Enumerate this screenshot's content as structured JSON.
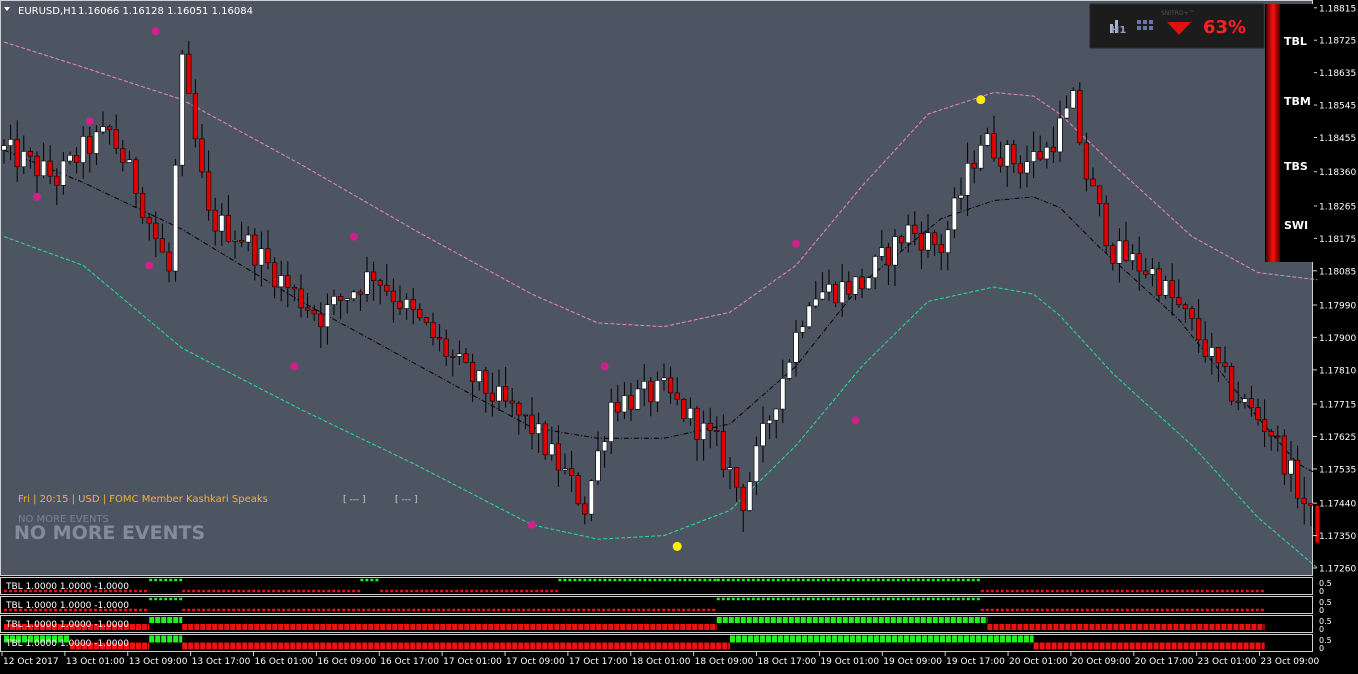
{
  "chart_header": {
    "symbol_tf": "EURUSD,H1",
    "ohlc": "1.16066 1.16128 1.16051 1.16084"
  },
  "news": {
    "line": "Fri  |  20:15  |  USD  |  FOMC Member Kashkari Speaks",
    "slot1": "[ --- ]",
    "slot2": "[ --- ]",
    "no_more_small": "NO MORE EVENTS",
    "no_more_big": "NO MORE EVENTS"
  },
  "strength_widget": {
    "timeframe": "H1",
    "brand": "SNITRO+™",
    "direction": "down",
    "percent": "63%"
  },
  "side_panel": {
    "labels": [
      "TBL",
      "TBM",
      "TBS",
      "SWI"
    ]
  },
  "sub_panels": [
    {
      "label": "TBL 1.0000 1.0000 -1.0000",
      "scale_top": "0.5",
      "scale_bottom": "0"
    },
    {
      "label": "TBL 1.0000 1.0000 -1.0000",
      "scale_top": "0.5",
      "scale_bottom": "0"
    },
    {
      "label": "TBL 1.0000 1.0000 -1.0000",
      "scale_top": "0.5",
      "scale_bottom": "0"
    },
    {
      "label": "TBL 1.0000 1.0000 -1.0000",
      "scale_top": "0.5",
      "scale_bottom": "0"
    }
  ],
  "colors": {
    "chart_bg": "#4e5562",
    "bull": "#ffffff",
    "bear": "#e00000",
    "upper_band": "#e888c0",
    "lower_band": "#20e0a0",
    "mid_line": "#000000",
    "dot_magenta": "#d0208c",
    "dot_yellow": "#ffee00",
    "green": "#22ee22",
    "red": "#ee1111"
  },
  "chart_data": {
    "type": "candlestick",
    "ylim": [
      1.1726,
      1.1882
    ],
    "y_ticks": [
      "1.18815",
      "1.18725",
      "1.18635",
      "1.18545",
      "1.18455",
      "1.18360",
      "1.18265",
      "1.18175",
      "1.18085",
      "1.17990",
      "1.17900",
      "1.17810",
      "1.17715",
      "1.17625",
      "1.17535",
      "1.17440",
      "1.17350",
      "1.17260"
    ],
    "x_ticks": [
      "12 Oct 2017",
      "13 Oct 01:00",
      "13 Oct 09:00",
      "13 Oct 17:00",
      "16 Oct 01:00",
      "16 Oct 09:00",
      "16 Oct 17:00",
      "17 Oct 01:00",
      "17 Oct 09:00",
      "17 Oct 17:00",
      "18 Oct 01:00",
      "18 Oct 09:00",
      "18 Oct 17:00",
      "19 Oct 01:00",
      "19 Oct 09:00",
      "19 Oct 17:00",
      "20 Oct 01:00",
      "20 Oct 09:00",
      "20 Oct 17:00",
      "23 Oct 01:00",
      "23 Oct 09:00"
    ],
    "bars_count": 200,
    "anchors": [
      [
        0,
        1.1842
      ],
      [
        8,
        1.1834
      ],
      [
        12,
        1.1842
      ],
      [
        16,
        1.1847
      ],
      [
        20,
        1.1832
      ],
      [
        25,
        1.1808
      ],
      [
        27,
        1.1865
      ],
      [
        31,
        1.1823
      ],
      [
        36,
        1.1818
      ],
      [
        44,
        1.1802
      ],
      [
        48,
        1.1796
      ],
      [
        56,
        1.1808
      ],
      [
        62,
        1.1796
      ],
      [
        70,
        1.178
      ],
      [
        80,
        1.1765
      ],
      [
        85,
        1.1752
      ],
      [
        88,
        1.1743
      ],
      [
        92,
        1.1772
      ],
      [
        100,
        1.1775
      ],
      [
        108,
        1.176
      ],
      [
        112,
        1.1745
      ],
      [
        116,
        1.1768
      ],
      [
        122,
        1.1802
      ],
      [
        130,
        1.1805
      ],
      [
        137,
        1.182
      ],
      [
        142,
        1.1815
      ],
      [
        148,
        1.1845
      ],
      [
        154,
        1.1838
      ],
      [
        158,
        1.1842
      ],
      [
        162,
        1.1855
      ],
      [
        164,
        1.1835
      ],
      [
        168,
        1.1814
      ],
      [
        174,
        1.1808
      ],
      [
        180,
        1.1793
      ],
      [
        186,
        1.1775
      ],
      [
        192,
        1.1764
      ],
      [
        196,
        1.1748
      ],
      [
        199,
        1.1736
      ]
    ],
    "overlays": {
      "mid_line": [
        [
          0,
          1.1842
        ],
        [
          12,
          1.1833
        ],
        [
          27,
          1.182
        ],
        [
          45,
          1.18
        ],
        [
          62,
          1.1783
        ],
        [
          80,
          1.1765
        ],
        [
          90,
          1.1762
        ],
        [
          100,
          1.1762
        ],
        [
          110,
          1.1766
        ],
        [
          120,
          1.1782
        ],
        [
          130,
          1.1805
        ],
        [
          142,
          1.1823
        ],
        [
          150,
          1.1828
        ],
        [
          156,
          1.1829
        ],
        [
          160,
          1.1826
        ],
        [
          166,
          1.1815
        ],
        [
          178,
          1.1795
        ],
        [
          188,
          1.1772
        ],
        [
          196,
          1.1755
        ],
        [
          199,
          1.1752
        ]
      ],
      "upper_band": [
        [
          0,
          1.1872
        ],
        [
          12,
          1.1865
        ],
        [
          27,
          1.1856
        ],
        [
          45,
          1.1838
        ],
        [
          62,
          1.182
        ],
        [
          80,
          1.1802
        ],
        [
          90,
          1.1794
        ],
        [
          100,
          1.1793
        ],
        [
          110,
          1.1797
        ],
        [
          120,
          1.181
        ],
        [
          130,
          1.1832
        ],
        [
          140,
          1.1852
        ],
        [
          150,
          1.1858
        ],
        [
          156,
          1.1857
        ],
        [
          160,
          1.1852
        ],
        [
          168,
          1.1838
        ],
        [
          180,
          1.1818
        ],
        [
          190,
          1.1808
        ],
        [
          199,
          1.1806
        ]
      ],
      "lower_band": [
        [
          0,
          1.1818
        ],
        [
          12,
          1.181
        ],
        [
          27,
          1.1787
        ],
        [
          45,
          1.177
        ],
        [
          62,
          1.1755
        ],
        [
          80,
          1.1738
        ],
        [
          90,
          1.1734
        ],
        [
          100,
          1.1735
        ],
        [
          110,
          1.1742
        ],
        [
          120,
          1.176
        ],
        [
          130,
          1.1782
        ],
        [
          140,
          1.18
        ],
        [
          150,
          1.1804
        ],
        [
          156,
          1.1802
        ],
        [
          160,
          1.1796
        ],
        [
          168,
          1.178
        ],
        [
          180,
          1.176
        ],
        [
          190,
          1.174
        ],
        [
          199,
          1.1726
        ]
      ]
    },
    "markers": [
      {
        "bar": 5,
        "price": 1.1829,
        "color": "magenta"
      },
      {
        "bar": 13,
        "price": 1.185,
        "color": "magenta"
      },
      {
        "bar": 23,
        "price": 1.1875,
        "color": "magenta"
      },
      {
        "bar": 22,
        "price": 1.181,
        "color": "magenta"
      },
      {
        "bar": 44,
        "price": 1.1782,
        "color": "magenta"
      },
      {
        "bar": 53,
        "price": 1.1818,
        "color": "magenta"
      },
      {
        "bar": 80,
        "price": 1.1738,
        "color": "magenta"
      },
      {
        "bar": 91,
        "price": 1.1782,
        "color": "magenta"
      },
      {
        "bar": 102,
        "price": 1.1732,
        "color": "yellow"
      },
      {
        "bar": 120,
        "price": 1.1816,
        "color": "magenta"
      },
      {
        "bar": 129,
        "price": 1.1767,
        "color": "magenta"
      },
      {
        "bar": 148,
        "price": 1.1856,
        "color": "yellow"
      }
    ],
    "sub_segments": [
      [
        [
          0,
          22,
          "red"
        ],
        [
          22,
          27,
          "green"
        ],
        [
          27,
          54,
          "red"
        ],
        [
          54,
          57,
          "green"
        ],
        [
          57,
          84,
          "red"
        ],
        [
          84,
          108,
          "green"
        ],
        [
          108,
          148,
          "green"
        ],
        [
          148,
          191,
          "red"
        ]
      ],
      [
        [
          0,
          22,
          "red"
        ],
        [
          22,
          27,
          "green"
        ],
        [
          27,
          108,
          "red"
        ],
        [
          108,
          148,
          "green"
        ],
        [
          148,
          191,
          "red"
        ]
      ],
      [
        [
          0,
          22,
          "red"
        ],
        [
          22,
          27,
          "green"
        ],
        [
          27,
          108,
          "red"
        ],
        [
          108,
          149,
          "green"
        ],
        [
          149,
          191,
          "red"
        ]
      ],
      [
        [
          0,
          10,
          "green"
        ],
        [
          10,
          22,
          "red"
        ],
        [
          22,
          27,
          "green"
        ],
        [
          27,
          110,
          "red"
        ],
        [
          110,
          156,
          "green"
        ],
        [
          156,
          191,
          "red"
        ]
      ]
    ]
  }
}
